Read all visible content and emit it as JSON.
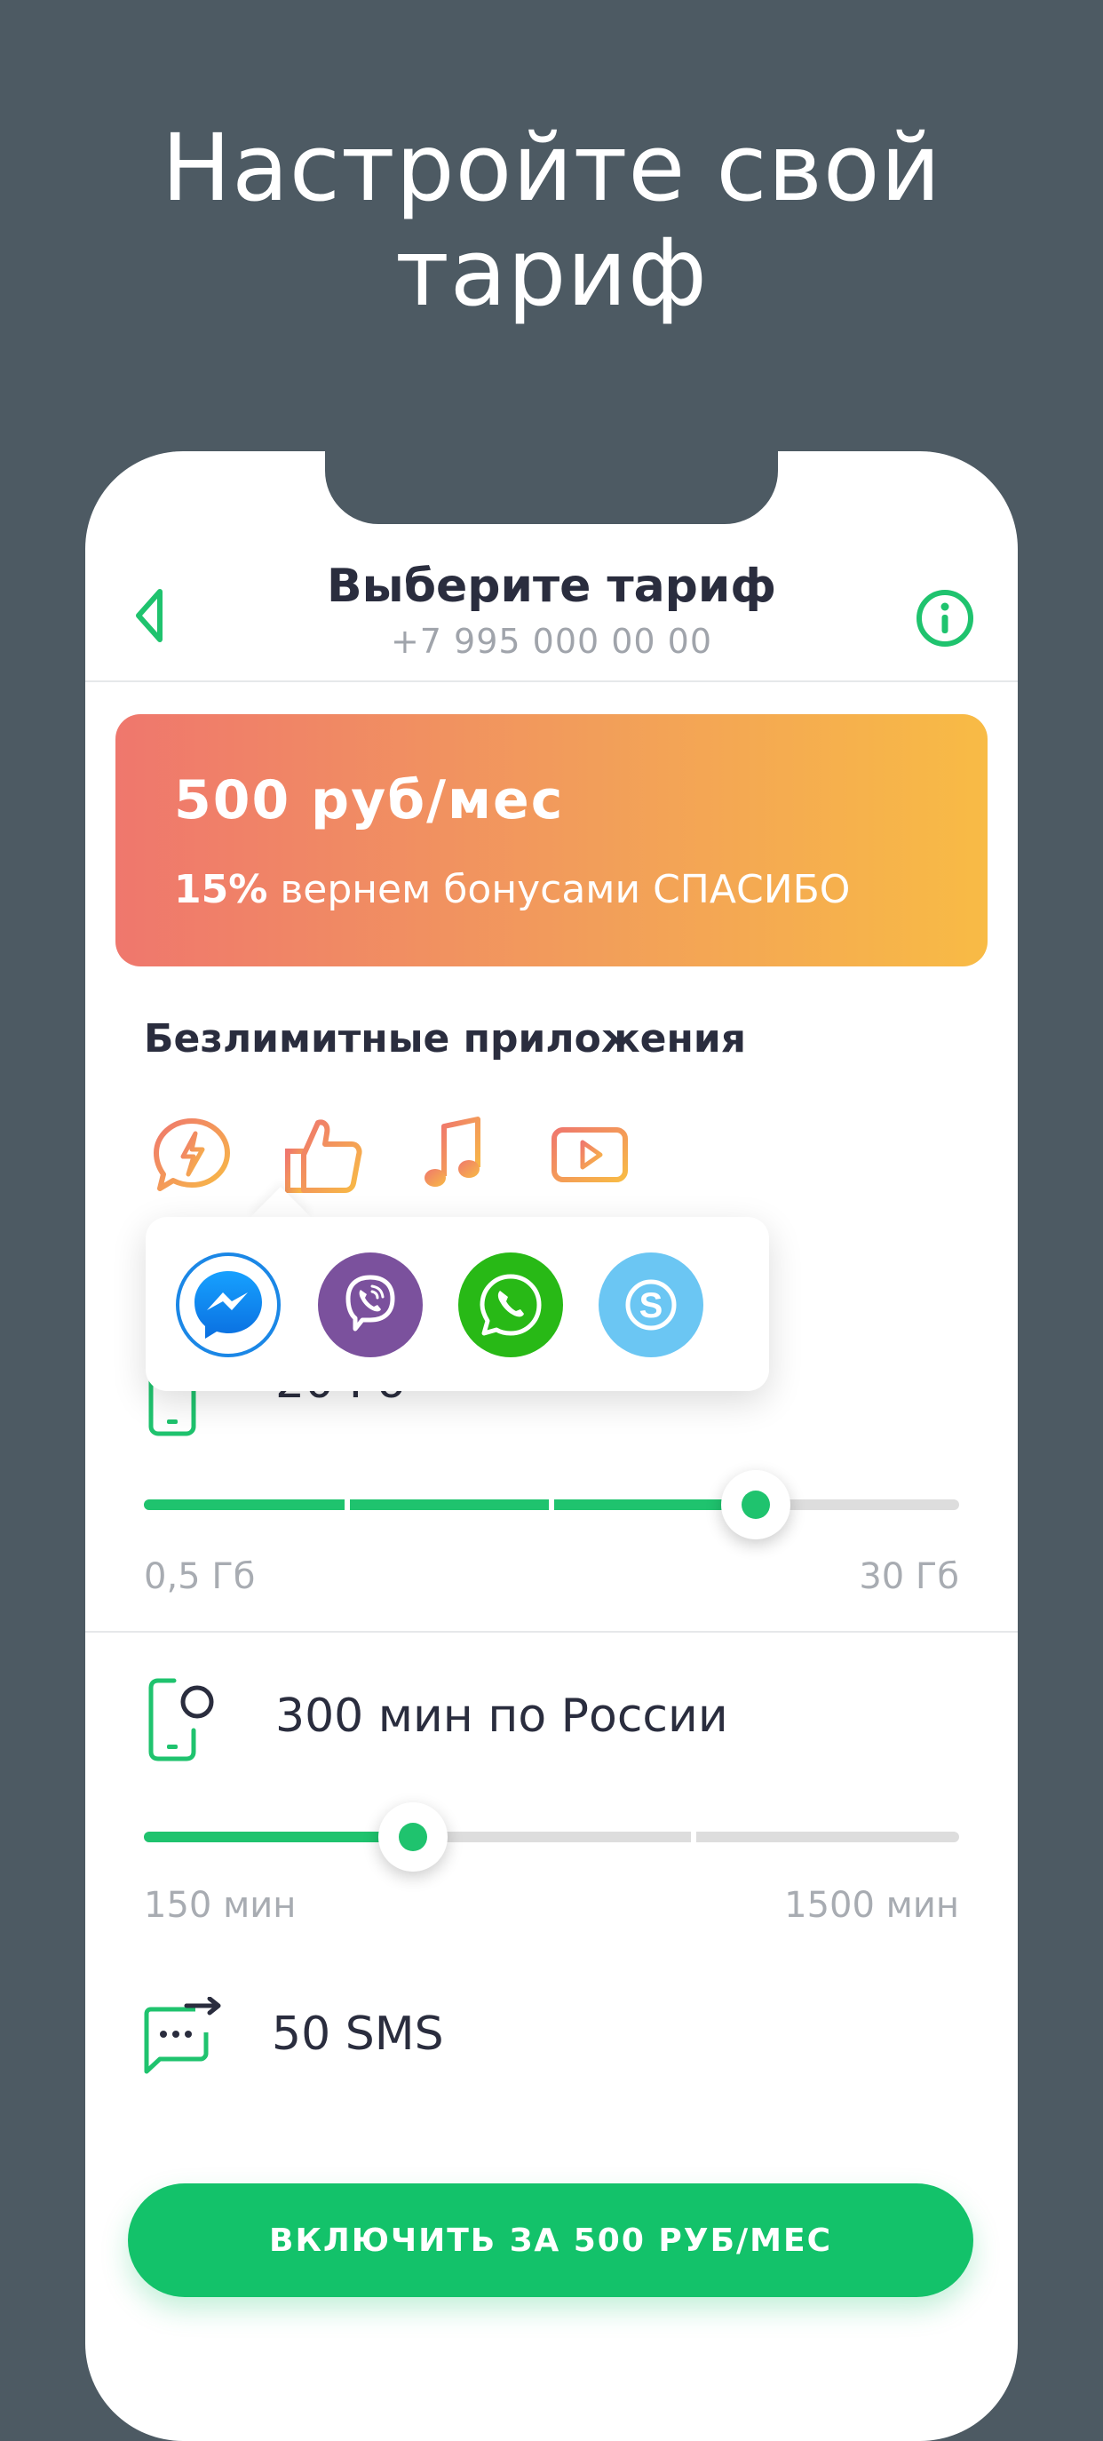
{
  "promo": {
    "title_line1": "Настройте свой",
    "title_line2": "тариф"
  },
  "header": {
    "title": "Выберите тариф",
    "phone": "+7 995 000 00 00"
  },
  "price_card": {
    "price": "500 руб/мес",
    "bonus_percent": "15%",
    "bonus_text": "вернем бонусами СПАСИБО"
  },
  "apps": {
    "title": "Безлимитные приложения",
    "icons": [
      "messenger-bubble-icon",
      "thumbs-up-icon",
      "music-note-icon",
      "video-play-icon"
    ],
    "popup_apps": [
      "messenger-icon",
      "viber-icon",
      "whatsapp-icon",
      "skype-icon"
    ]
  },
  "internet": {
    "value": "20 Гб",
    "min_label": "0,5 Гб",
    "max_label": "30 Гб",
    "position": 0.75
  },
  "minutes": {
    "value": "300 мин по России",
    "min_label": "150 мин",
    "max_label": "1500 мин",
    "position": 0.33
  },
  "sms": {
    "value": "50 SMS"
  },
  "cta": {
    "label": "ВКЛЮЧИТЬ ЗА 500 РУБ/МЕС"
  },
  "colors": {
    "accent": "#1fc36e",
    "orange": "#f29e5a",
    "background": "#4d5a63",
    "text": "#2a2d3e"
  }
}
